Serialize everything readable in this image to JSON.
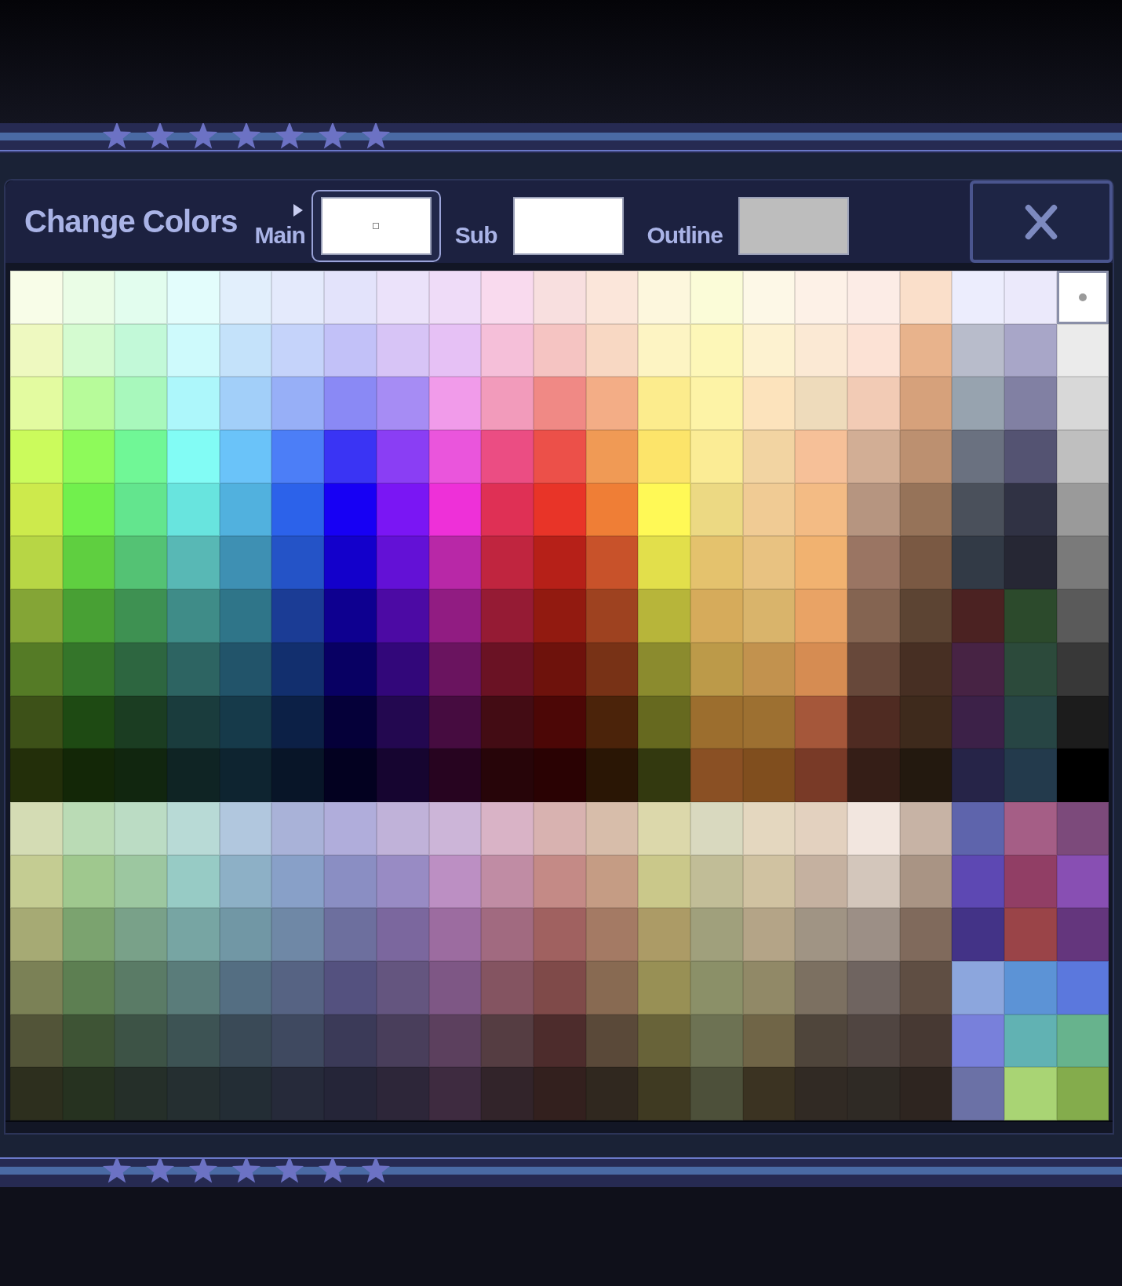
{
  "title": "Change Colors",
  "slots": [
    {
      "label": "Main",
      "color": "#ffffff",
      "selected": true
    },
    {
      "label": "Sub",
      "color": "#ffffff",
      "selected": false
    },
    {
      "label": "Outline",
      "color": "#bdbdbd",
      "selected": false
    }
  ],
  "palette": {
    "rows": [
      [
        {
          "color": "#f8fde8",
          "selected": false
        },
        {
          "color": "#eafde6",
          "selected": false
        },
        {
          "color": "#e2fdee",
          "selected": false
        },
        {
          "color": "#e3fdfc",
          "selected": false
        },
        {
          "color": "#e2effc",
          "selected": false
        },
        {
          "color": "#e4eafc",
          "selected": false
        },
        {
          "color": "#e3e3fb",
          "selected": false
        },
        {
          "color": "#ebe2fa",
          "selected": false
        },
        {
          "color": "#efdcf8",
          "selected": false
        },
        {
          "color": "#f9daee",
          "selected": false
        },
        {
          "color": "#f8dfdf",
          "selected": false
        },
        {
          "color": "#fbe6da",
          "selected": false
        },
        {
          "color": "#fdf7dd",
          "selected": false
        },
        {
          "color": "#fbfcd8",
          "selected": false
        },
        {
          "color": "#fdf8e7",
          "selected": false
        },
        {
          "color": "#fdf1e7",
          "selected": false
        },
        {
          "color": "#fcece6",
          "selected": false
        },
        {
          "color": "#fadfca",
          "selected": false
        },
        {
          "color": "#ecedfd",
          "selected": false
        },
        {
          "color": "#ebe9fb",
          "selected": false
        },
        {
          "color": "#ffffff",
          "selected": true
        }
      ],
      [
        {
          "color": "#eef9c0",
          "selected": false
        },
        {
          "color": "#d4fbd0",
          "selected": false
        },
        {
          "color": "#c2f9d8",
          "selected": false
        },
        {
          "color": "#cefafc",
          "selected": false
        },
        {
          "color": "#c4e2fa",
          "selected": false
        },
        {
          "color": "#c5d3fa",
          "selected": false
        },
        {
          "color": "#c2c1f8",
          "selected": false
        },
        {
          "color": "#d7c4f6",
          "selected": false
        },
        {
          "color": "#e6c1f5",
          "selected": false
        },
        {
          "color": "#f5bfd9",
          "selected": false
        },
        {
          "color": "#f5c4c2",
          "selected": false
        },
        {
          "color": "#f8d8c3",
          "selected": false
        },
        {
          "color": "#fdf4c3",
          "selected": false
        },
        {
          "color": "#fdf7b8",
          "selected": false
        },
        {
          "color": "#fdf2d0",
          "selected": false
        },
        {
          "color": "#fbe9d4",
          "selected": false
        },
        {
          "color": "#fce2d5",
          "selected": false
        },
        {
          "color": "#e8b38c",
          "selected": false
        },
        {
          "color": "#b8bccb",
          "selected": false
        },
        {
          "color": "#a8a6c8",
          "selected": false
        },
        {
          "color": "#ebebeb",
          "selected": false
        }
      ],
      [
        {
          "color": "#e3fba0",
          "selected": false
        },
        {
          "color": "#b7fb9a",
          "selected": false
        },
        {
          "color": "#a8f8bc",
          "selected": false
        },
        {
          "color": "#adf7fb",
          "selected": false
        },
        {
          "color": "#a2cff9",
          "selected": false
        },
        {
          "color": "#97aff7",
          "selected": false
        },
        {
          "color": "#8a89f5",
          "selected": false
        },
        {
          "color": "#a68cf4",
          "selected": false
        },
        {
          "color": "#f19bea",
          "selected": false
        },
        {
          "color": "#f29bbb",
          "selected": false
        },
        {
          "color": "#f08985",
          "selected": false
        },
        {
          "color": "#f3ad86",
          "selected": false
        },
        {
          "color": "#fcec8d",
          "selected": false
        },
        {
          "color": "#fdf3a6",
          "selected": false
        },
        {
          "color": "#fce3bc",
          "selected": false
        },
        {
          "color": "#eedbbb",
          "selected": false
        },
        {
          "color": "#f2cbb5",
          "selected": false
        },
        {
          "color": "#d6a17b",
          "selected": false
        },
        {
          "color": "#97a3af",
          "selected": false
        },
        {
          "color": "#8180a3",
          "selected": false
        },
        {
          "color": "#d8d8d8",
          "selected": false
        }
      ],
      [
        {
          "color": "#cbfb5c",
          "selected": false
        },
        {
          "color": "#8efa5a",
          "selected": false
        },
        {
          "color": "#70f796",
          "selected": false
        },
        {
          "color": "#82fcf5",
          "selected": false
        },
        {
          "color": "#6ac3f9",
          "selected": false
        },
        {
          "color": "#4c7ef7",
          "selected": false
        },
        {
          "color": "#3a34f4",
          "selected": false
        },
        {
          "color": "#8a3ef4",
          "selected": false
        },
        {
          "color": "#ea55dc",
          "selected": false
        },
        {
          "color": "#eb4d83",
          "selected": false
        },
        {
          "color": "#ec5049",
          "selected": false
        },
        {
          "color": "#f09a55",
          "selected": false
        },
        {
          "color": "#fce46a",
          "selected": false
        },
        {
          "color": "#fbec95",
          "selected": false
        },
        {
          "color": "#f2d4a2",
          "selected": false
        },
        {
          "color": "#f6c098",
          "selected": false
        },
        {
          "color": "#d2ae95",
          "selected": false
        },
        {
          "color": "#bc9070",
          "selected": false
        },
        {
          "color": "#6a7180",
          "selected": false
        },
        {
          "color": "#545372",
          "selected": false
        },
        {
          "color": "#bfbfbf",
          "selected": false
        }
      ],
      [
        {
          "color": "#cdea4c",
          "selected": false
        },
        {
          "color": "#71f04d",
          "selected": false
        },
        {
          "color": "#63e58e",
          "selected": false
        },
        {
          "color": "#68e4de",
          "selected": false
        },
        {
          "color": "#51b1de",
          "selected": false
        },
        {
          "color": "#2c62ea",
          "selected": false
        },
        {
          "color": "#1700f4",
          "selected": false
        },
        {
          "color": "#7a16f4",
          "selected": false
        },
        {
          "color": "#ee30d8",
          "selected": false
        },
        {
          "color": "#df3055",
          "selected": false
        },
        {
          "color": "#e83428",
          "selected": false
        },
        {
          "color": "#ef7e36",
          "selected": false
        },
        {
          "color": "#fff956",
          "selected": false
        },
        {
          "color": "#ecd983",
          "selected": false
        },
        {
          "color": "#f0cb94",
          "selected": false
        },
        {
          "color": "#f3bb84",
          "selected": false
        },
        {
          "color": "#b69580",
          "selected": false
        },
        {
          "color": "#967359",
          "selected": false
        },
        {
          "color": "#4a505b",
          "selected": false
        },
        {
          "color": "#303244",
          "selected": false
        },
        {
          "color": "#9a9a9a",
          "selected": false
        }
      ],
      [
        {
          "color": "#b7d645",
          "selected": false
        },
        {
          "color": "#5fcf40",
          "selected": false
        },
        {
          "color": "#54c274",
          "selected": false
        },
        {
          "color": "#58b8b5",
          "selected": false
        },
        {
          "color": "#3e90b3",
          "selected": false
        },
        {
          "color": "#2453c7",
          "selected": false
        },
        {
          "color": "#1300cb",
          "selected": false
        },
        {
          "color": "#6311d6",
          "selected": false
        },
        {
          "color": "#b828a7",
          "selected": false
        },
        {
          "color": "#c0253f",
          "selected": false
        },
        {
          "color": "#b62018",
          "selected": false
        },
        {
          "color": "#c8522a",
          "selected": false
        },
        {
          "color": "#e2df4b",
          "selected": false
        },
        {
          "color": "#e4c26d",
          "selected": false
        },
        {
          "color": "#e8c281",
          "selected": false
        },
        {
          "color": "#f1b270",
          "selected": false
        },
        {
          "color": "#9a7563",
          "selected": false
        },
        {
          "color": "#7a5943",
          "selected": false
        },
        {
          "color": "#323a46",
          "selected": false
        },
        {
          "color": "#262734",
          "selected": false
        },
        {
          "color": "#7a7a7a",
          "selected": false
        }
      ],
      [
        {
          "color": "#84a536",
          "selected": false
        },
        {
          "color": "#48a034",
          "selected": false
        },
        {
          "color": "#3e9152",
          "selected": false
        },
        {
          "color": "#3f8c88",
          "selected": false
        },
        {
          "color": "#2f7589",
          "selected": false
        },
        {
          "color": "#1b3c95",
          "selected": false
        },
        {
          "color": "#0e0090",
          "selected": false
        },
        {
          "color": "#4c0aa4",
          "selected": false
        },
        {
          "color": "#911c82",
          "selected": false
        },
        {
          "color": "#951b34",
          "selected": false
        },
        {
          "color": "#921a10",
          "selected": false
        },
        {
          "color": "#9e4220",
          "selected": false
        },
        {
          "color": "#b7b53a",
          "selected": false
        },
        {
          "color": "#d6ab5b",
          "selected": false
        },
        {
          "color": "#d9b46b",
          "selected": false
        },
        {
          "color": "#e9a365",
          "selected": false
        },
        {
          "color": "#846451",
          "selected": false
        },
        {
          "color": "#5c4433",
          "selected": false
        },
        {
          "color": "#4b2222",
          "selected": false
        },
        {
          "color": "#2c4a2c",
          "selected": false
        },
        {
          "color": "#5a5a5a",
          "selected": false
        }
      ],
      [
        {
          "color": "#557b26",
          "selected": false
        },
        {
          "color": "#34752a",
          "selected": false
        },
        {
          "color": "#2d6640",
          "selected": false
        },
        {
          "color": "#2d6462",
          "selected": false
        },
        {
          "color": "#22546a",
          "selected": false
        },
        {
          "color": "#122f6e",
          "selected": false
        },
        {
          "color": "#080063",
          "selected": false
        },
        {
          "color": "#32077a",
          "selected": false
        },
        {
          "color": "#6a145f",
          "selected": false
        },
        {
          "color": "#6a1224",
          "selected": false
        },
        {
          "color": "#6e120c",
          "selected": false
        },
        {
          "color": "#783216",
          "selected": false
        },
        {
          "color": "#8b8b2e",
          "selected": false
        },
        {
          "color": "#bc9a49",
          "selected": false
        },
        {
          "color": "#c2924e",
          "selected": false
        },
        {
          "color": "#d68c52",
          "selected": false
        },
        {
          "color": "#67483a",
          "selected": false
        },
        {
          "color": "#472f23",
          "selected": false
        },
        {
          "color": "#472344",
          "selected": false
        },
        {
          "color": "#2c4a3b",
          "selected": false
        },
        {
          "color": "#383838",
          "selected": false
        }
      ],
      [
        {
          "color": "#3d5118",
          "selected": false
        },
        {
          "color": "#1e4a13",
          "selected": false
        },
        {
          "color": "#1b3d22",
          "selected": false
        },
        {
          "color": "#1a3c3d",
          "selected": false
        },
        {
          "color": "#163a4a",
          "selected": false
        },
        {
          "color": "#0c2046",
          "selected": false
        },
        {
          "color": "#050039",
          "selected": false
        },
        {
          "color": "#230850",
          "selected": false
        },
        {
          "color": "#460c40",
          "selected": false
        },
        {
          "color": "#430c14",
          "selected": false
        },
        {
          "color": "#4c0706",
          "selected": false
        },
        {
          "color": "#4b230a",
          "selected": false
        },
        {
          "color": "#66691f",
          "selected": false
        },
        {
          "color": "#9c6e2e",
          "selected": false
        },
        {
          "color": "#9d7031",
          "selected": false
        },
        {
          "color": "#a5573a",
          "selected": false
        },
        {
          "color": "#4f2b22",
          "selected": false
        },
        {
          "color": "#3e2a1c",
          "selected": false
        },
        {
          "color": "#3c2148",
          "selected": false
        },
        {
          "color": "#274544",
          "selected": false
        },
        {
          "color": "#1c1c1c",
          "selected": false
        }
      ],
      [
        {
          "color": "#232f0a",
          "selected": false
        },
        {
          "color": "#132707",
          "selected": false
        },
        {
          "color": "#11260f",
          "selected": false
        },
        {
          "color": "#0f2424",
          "selected": false
        },
        {
          "color": "#0e2430",
          "selected": false
        },
        {
          "color": "#081528",
          "selected": false
        },
        {
          "color": "#030120",
          "selected": false
        },
        {
          "color": "#160530",
          "selected": false
        },
        {
          "color": "#270420",
          "selected": false
        },
        {
          "color": "#270509",
          "selected": false
        },
        {
          "color": "#2a0203",
          "selected": false
        },
        {
          "color": "#2a1605",
          "selected": false
        },
        {
          "color": "#33390f",
          "selected": false
        },
        {
          "color": "#8a5024",
          "selected": false
        },
        {
          "color": "#804e1e",
          "selected": false
        },
        {
          "color": "#793a27",
          "selected": false
        },
        {
          "color": "#351e17",
          "selected": false
        },
        {
          "color": "#23190f",
          "selected": false
        },
        {
          "color": "#262448",
          "selected": false
        },
        {
          "color": "#233a4c",
          "selected": false
        },
        {
          "color": "#000000",
          "selected": false
        }
      ],
      [
        {
          "color": "#d4dcb4",
          "selected": false
        },
        {
          "color": "#badbb5",
          "selected": false
        },
        {
          "color": "#bbdcc4",
          "selected": false
        },
        {
          "color": "#b8dad6",
          "selected": false
        },
        {
          "color": "#b1c7de",
          "selected": false
        },
        {
          "color": "#a9b2d8",
          "selected": false
        },
        {
          "color": "#b0addb",
          "selected": false
        },
        {
          "color": "#c0b2d9",
          "selected": false
        },
        {
          "color": "#ccb5d8",
          "selected": false
        },
        {
          "color": "#d9b3c6",
          "selected": false
        },
        {
          "color": "#d8b2b0",
          "selected": false
        },
        {
          "color": "#d7bdaa",
          "selected": false
        },
        {
          "color": "#dcd8ab",
          "selected": false
        },
        {
          "color": "#d9d9bf",
          "selected": false
        },
        {
          "color": "#e4d7bf",
          "selected": false
        },
        {
          "color": "#e3d1bf",
          "selected": false
        },
        {
          "color": "#f2e6df",
          "selected": false
        },
        {
          "color": "#c7b3a5",
          "selected": false
        },
        {
          "color": "#5e64ac",
          "selected": false
        },
        {
          "color": "#a55e86",
          "selected": false
        },
        {
          "color": "#7c4a7b",
          "selected": false
        }
      ],
      [
        {
          "color": "#c4cc92",
          "selected": false
        },
        {
          "color": "#9fc88e",
          "selected": false
        },
        {
          "color": "#9cc7a0",
          "selected": false
        },
        {
          "color": "#97cbc5",
          "selected": false
        },
        {
          "color": "#8db0c6",
          "selected": false
        },
        {
          "color": "#88a0c8",
          "selected": false
        },
        {
          "color": "#8a8ec3",
          "selected": false
        },
        {
          "color": "#988bc4",
          "selected": false
        },
        {
          "color": "#bc8fc3",
          "selected": false
        },
        {
          "color": "#c08ca4",
          "selected": false
        },
        {
          "color": "#c48a86",
          "selected": false
        },
        {
          "color": "#c59c84",
          "selected": false
        },
        {
          "color": "#cac88a",
          "selected": false
        },
        {
          "color": "#c1bd97",
          "selected": false
        },
        {
          "color": "#d0c2a1",
          "selected": false
        },
        {
          "color": "#c5b1a0",
          "selected": false
        },
        {
          "color": "#d3c6bb",
          "selected": false
        },
        {
          "color": "#a99484",
          "selected": false
        },
        {
          "color": "#5d48b3",
          "selected": false
        },
        {
          "color": "#913e65",
          "selected": false
        },
        {
          "color": "#884fb3",
          "selected": false
        }
      ],
      [
        {
          "color": "#a6aa74",
          "selected": false
        },
        {
          "color": "#7ba36f",
          "selected": false
        },
        {
          "color": "#79a189",
          "selected": false
        },
        {
          "color": "#77a5a3",
          "selected": false
        },
        {
          "color": "#7197a5",
          "selected": false
        },
        {
          "color": "#6f88a6",
          "selected": false
        },
        {
          "color": "#6d6f9e",
          "selected": false
        },
        {
          "color": "#7b679e",
          "selected": false
        },
        {
          "color": "#9c6ca0",
          "selected": false
        },
        {
          "color": "#a16a80",
          "selected": false
        },
        {
          "color": "#a06160",
          "selected": false
        },
        {
          "color": "#a47a64",
          "selected": false
        },
        {
          "color": "#ac9b66",
          "selected": false
        },
        {
          "color": "#a0a07c",
          "selected": false
        },
        {
          "color": "#b4a487",
          "selected": false
        },
        {
          "color": "#a09484",
          "selected": false
        },
        {
          "color": "#9c8f86",
          "selected": false
        },
        {
          "color": "#806a5c",
          "selected": false
        },
        {
          "color": "#433387",
          "selected": false
        },
        {
          "color": "#9a4448",
          "selected": false
        },
        {
          "color": "#64367d",
          "selected": false
        }
      ],
      [
        {
          "color": "#7b8156",
          "selected": false
        },
        {
          "color": "#5d7f52",
          "selected": false
        },
        {
          "color": "#5a7b66",
          "selected": false
        },
        {
          "color": "#5a7c7a",
          "selected": false
        },
        {
          "color": "#546e82",
          "selected": false
        },
        {
          "color": "#566383",
          "selected": false
        },
        {
          "color": "#54517f",
          "selected": false
        },
        {
          "color": "#64557f",
          "selected": false
        },
        {
          "color": "#7e5785",
          "selected": false
        },
        {
          "color": "#845461",
          "selected": false
        },
        {
          "color": "#7f4a49",
          "selected": false
        },
        {
          "color": "#886a52",
          "selected": false
        },
        {
          "color": "#989055",
          "selected": false
        },
        {
          "color": "#8b9068",
          "selected": false
        },
        {
          "color": "#918967",
          "selected": false
        },
        {
          "color": "#7c7061",
          "selected": false
        },
        {
          "color": "#6f6460",
          "selected": false
        },
        {
          "color": "#5f4e43",
          "selected": false
        },
        {
          "color": "#8ca6dd",
          "selected": false
        },
        {
          "color": "#5c93d6",
          "selected": false
        },
        {
          "color": "#5b78dd",
          "selected": false
        }
      ],
      [
        {
          "color": "#525438",
          "selected": false
        },
        {
          "color": "#3e5435",
          "selected": false
        },
        {
          "color": "#3d5346",
          "selected": false
        },
        {
          "color": "#3d5354",
          "selected": false
        },
        {
          "color": "#3a4a57",
          "selected": false
        },
        {
          "color": "#3f4960",
          "selected": false
        },
        {
          "color": "#3b3a58",
          "selected": false
        },
        {
          "color": "#493e5b",
          "selected": false
        },
        {
          "color": "#5c405e",
          "selected": false
        },
        {
          "color": "#553d42",
          "selected": false
        },
        {
          "color": "#4d2c2c",
          "selected": false
        },
        {
          "color": "#5a4939",
          "selected": false
        },
        {
          "color": "#686339",
          "selected": false
        },
        {
          "color": "#6d7253",
          "selected": false
        },
        {
          "color": "#706547",
          "selected": false
        },
        {
          "color": "#4f453b",
          "selected": false
        },
        {
          "color": "#504541",
          "selected": false
        },
        {
          "color": "#473933",
          "selected": false
        },
        {
          "color": "#7880db",
          "selected": false
        },
        {
          "color": "#61b2b3",
          "selected": false
        },
        {
          "color": "#67b38d",
          "selected": false
        }
      ],
      [
        {
          "color": "#2d2f1e",
          "selected": false
        },
        {
          "color": "#263220",
          "selected": false
        },
        {
          "color": "#252f29",
          "selected": false
        },
        {
          "color": "#252f31",
          "selected": false
        },
        {
          "color": "#232d35",
          "selected": false
        },
        {
          "color": "#262a3a",
          "selected": false
        },
        {
          "color": "#252538",
          "selected": false
        },
        {
          "color": "#2d2639",
          "selected": false
        },
        {
          "color": "#3e2b40",
          "selected": false
        },
        {
          "color": "#32242a",
          "selected": false
        },
        {
          "color": "#33201e",
          "selected": false
        },
        {
          "color": "#30281f",
          "selected": false
        },
        {
          "color": "#3f3a22",
          "selected": false
        },
        {
          "color": "#4d503a",
          "selected": false
        },
        {
          "color": "#3b3322",
          "selected": false
        },
        {
          "color": "#312a24",
          "selected": false
        },
        {
          "color": "#2f2a25",
          "selected": false
        },
        {
          "color": "#2e2520",
          "selected": false
        },
        {
          "color": "#6b71a6",
          "selected": false
        },
        {
          "color": "#a9d474",
          "selected": false
        },
        {
          "color": "#84ac4c",
          "selected": false
        }
      ]
    ]
  }
}
